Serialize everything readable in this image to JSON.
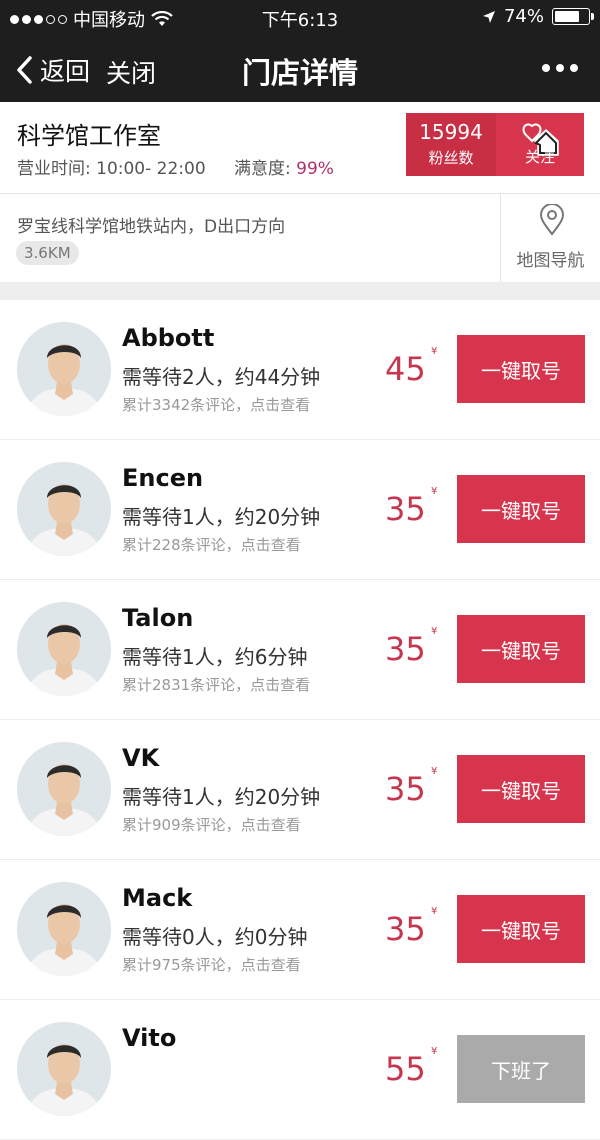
{
  "status_bar": {
    "carrier": "中国移动",
    "time": "下午6:13",
    "battery_text": "74%",
    "battery_level": 0.74
  },
  "nav": {
    "back_label": "返回",
    "close_label": "关闭",
    "title": "门店详情"
  },
  "store": {
    "name": "科学馆工作室",
    "hours": "营业时间: 10:00- 22:00",
    "satisfaction_label": "满意度:",
    "satisfaction_value": "99%",
    "fans_count": "15994",
    "fans_label": "粉丝数",
    "follow_label": "关注"
  },
  "address": {
    "text": "罗宝线科学馆地铁站内，D出口方向",
    "distance": "3.6KM",
    "map_label": "地图导航"
  },
  "currency": "¥",
  "barbers": [
    {
      "name": "Abbott",
      "wait": "需等待2人，约44分钟",
      "reviews": "累计3342条评论，点击查看",
      "price": "45",
      "action": "一键取号"
    },
    {
      "name": "Encen",
      "wait": "需等待1人，约20分钟",
      "reviews": "累计228条评论，点击查看",
      "price": "35",
      "action": "一键取号"
    },
    {
      "name": "Talon",
      "wait": "需等待1人，约6分钟",
      "reviews": "累计2831条评论，点击查看",
      "price": "35",
      "action": "一键取号"
    },
    {
      "name": "VK",
      "wait": "需等待1人，约20分钟",
      "reviews": "累计909条评论，点击查看",
      "price": "35",
      "action": "一键取号"
    },
    {
      "name": "Mack",
      "wait": "需等待0人，约0分钟",
      "reviews": "累计975条评论，点击查看",
      "price": "35",
      "action": "一键取号"
    },
    {
      "name": "Vito",
      "wait": "",
      "reviews": "",
      "price": "55",
      "action": "下班了"
    }
  ],
  "colors": {
    "accent": "#d7354d",
    "price": "#c4374e",
    "bar": "#1e1e1e"
  }
}
